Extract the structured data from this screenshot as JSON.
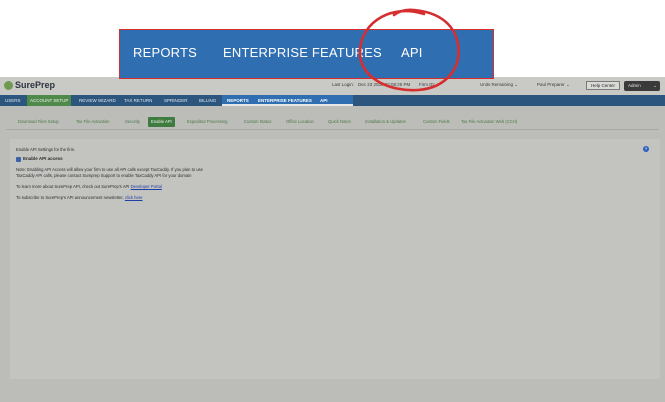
{
  "brand": {
    "name": "SurePrep"
  },
  "topbar": {
    "last_login_label": "Last Login:",
    "last_login_value": "Dec 23 2020 02:08:25 PM",
    "firm_id_label": "Firm ID:",
    "units_label": "Units Remaining",
    "user_name": "Paul Preparer",
    "help_label": "Help Center",
    "admin_label": "Admin"
  },
  "nav": {
    "items": [
      "USERS",
      "ACCOUNT SETUP",
      "REVIEW WIZARD",
      "TAX RETURN",
      "SPRINGER",
      "BILLING"
    ],
    "active": "ACCOUNT SETUP"
  },
  "submenu": {
    "items": [
      "REPORTS",
      "ENTERPRISE FEATURES",
      "API"
    ]
  },
  "subtabs": {
    "items": [
      "Download Files Setup",
      "Tax File Activation",
      "Security",
      "Enable API",
      "Expedited Processing",
      "Custom Status",
      "Office Location",
      "Quick Notes",
      "Installation & Updates",
      "Custom Fields",
      "Tax File Activation Web (CCH)"
    ],
    "active": "Enable API"
  },
  "content": {
    "intro": "Enable API Settings for the firm.",
    "checkbox_label": "Enable API access",
    "checkbox_checked": true,
    "note_line1": "Note: Enabling API Access will allow your firm to use all API calls except TaxCaddy. If you plan to use",
    "note_line2": "TaxCaddy API calls, please contact Sureprep Support to enable TaxCaddy API for your domain",
    "learn_prefix": "To learn more about SurePrep API, check out SurePrep's API",
    "learn_link": "Developer Portal",
    "subscribe_prefix": "To subscribe to SurePrep's API announcement newsletter,",
    "subscribe_link": "click here"
  },
  "zoom": {
    "items": [
      "REPORTS",
      "ENTERPRISE FEATURES",
      "API"
    ]
  },
  "colors": {
    "nav_blue": "#2f6fb1",
    "accent_green": "#3f7c3f",
    "annotation_red": "#d62e2e"
  }
}
